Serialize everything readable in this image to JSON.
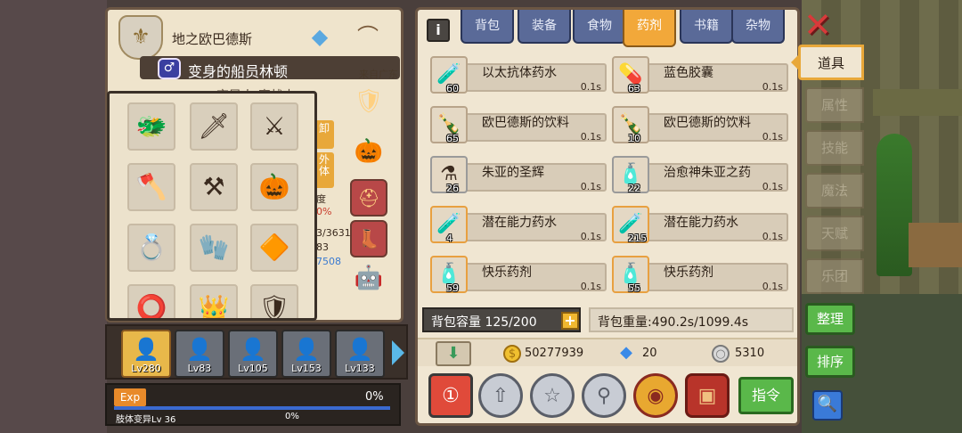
{
  "character": {
    "title": "地之欧巴德斯",
    "name": "变身的船员林顿",
    "origin": "来自广东",
    "subtitle": "变异人·魔战士",
    "tag_1": "卸",
    "tag_2": "外体",
    "stat_1": "度",
    "stat_2": "0%",
    "stat_3": "3/3631",
    "stat_4": "83",
    "stat_5": "7508",
    "rank_icon": "shield-wings-icon",
    "top_icons": [
      "crystal-altar-icon",
      "hanger-icon"
    ],
    "right_slots": [
      "emerald-shield-icon",
      "pumpkin-icon",
      "helmet-icon",
      "boots-icon",
      "robot-icon"
    ]
  },
  "equipment": {
    "items": [
      {
        "icon": "dragon-gauntlet-icon",
        "glyph": "🐲"
      },
      {
        "icon": "flame-blade-icon",
        "glyph": "🗡"
      },
      {
        "icon": "spear-icon",
        "glyph": "⚔"
      },
      {
        "icon": "dark-axe-icon",
        "glyph": "🪓"
      },
      {
        "icon": "shadow-blade-icon",
        "glyph": "⚒"
      },
      {
        "icon": "pumpkin-staff-icon",
        "glyph": "🎃"
      },
      {
        "icon": "gold-ring-icon",
        "glyph": "💍"
      },
      {
        "icon": "white-glove-icon",
        "glyph": "🧤"
      },
      {
        "icon": "red-amulet-icon",
        "glyph": "🔶"
      },
      {
        "icon": "dark-ring-icon",
        "glyph": "⭕"
      },
      {
        "icon": "gold-crown-icon",
        "glyph": "👑"
      },
      {
        "icon": "spike-shield-icon",
        "glyph": "🛡"
      }
    ]
  },
  "party": [
    {
      "level": "Lv280",
      "active": true
    },
    {
      "level": "Lv83",
      "active": false
    },
    {
      "level": "Lv105",
      "active": false
    },
    {
      "level": "Lv153",
      "active": false
    },
    {
      "level": "Lv133",
      "active": false
    }
  ],
  "exp": {
    "label": "Exp",
    "percent": "0%",
    "progress": 0,
    "sub_label": "肢体变异Lv 36",
    "sub_percent": "0%"
  },
  "inventory": {
    "tabs": [
      "背包",
      "装备",
      "食物",
      "药剂",
      "书籍",
      "杂物"
    ],
    "active_tab": "药剂",
    "items": [
      {
        "name": "以太抗体药水",
        "count": "60",
        "weight": "0.1s",
        "icon": "purple-potion-icon",
        "glyph": "🧪"
      },
      {
        "name": "蓝色胶囊",
        "count": "63",
        "weight": "0.1s",
        "icon": "blue-capsule-icon",
        "glyph": "💊"
      },
      {
        "name": "欧巴德斯的饮料",
        "count": "65",
        "weight": "0.1s",
        "icon": "cola-bottle-icon",
        "glyph": "🍾"
      },
      {
        "name": "欧巴德斯的饮料",
        "count": "10",
        "weight": "0.1s",
        "icon": "cola-bottle-icon",
        "glyph": "🍾"
      },
      {
        "name": "朱亚的圣辉",
        "count": "26",
        "weight": "0.1s",
        "icon": "holy-flask-icon",
        "glyph": "⚗"
      },
      {
        "name": "治愈神朱亚之药",
        "count": "22",
        "weight": "0.1s",
        "icon": "green-vial-icon",
        "glyph": "🧴"
      },
      {
        "name": "潜在能力药水",
        "count": "4",
        "weight": "0.1s",
        "icon": "orange-potion-icon",
        "glyph": "🧪"
      },
      {
        "name": "潜在能力药水",
        "count": "215",
        "weight": "0.1s",
        "icon": "orange-potion-icon",
        "glyph": "🧪"
      },
      {
        "name": "快乐药剂",
        "count": "59",
        "weight": "0.1s",
        "icon": "happy-vial-icon",
        "glyph": "🧴"
      },
      {
        "name": "快乐药剂",
        "count": "55",
        "weight": "0.1s",
        "icon": "happy-vial-icon",
        "glyph": "🧴"
      }
    ],
    "capacity_text": "背包容量 125/200",
    "weight_text": "背包重量:490.2s/1099.4s",
    "gold": "50277939",
    "gems": "20",
    "coins": "5310",
    "command_label": "指令",
    "action_icons": [
      "potion-123-icon",
      "up-arrow-icon",
      "star-icon",
      "magnify-icon",
      "fire-orb-icon",
      "treasure-chest-icon"
    ]
  },
  "side_menu": {
    "tabs": [
      "道具",
      "属性",
      "技能",
      "魔法",
      "天赋",
      "乐团"
    ],
    "active": "道具",
    "organize_label": "整理",
    "sort_label": "排序"
  },
  "colors": {
    "panel_bg": "#f0e6d2",
    "tab_active": "#f2a83a",
    "tab_inactive": "#5a6a98",
    "button_green": "#5ab84a",
    "close_red": "#d83a3a"
  }
}
